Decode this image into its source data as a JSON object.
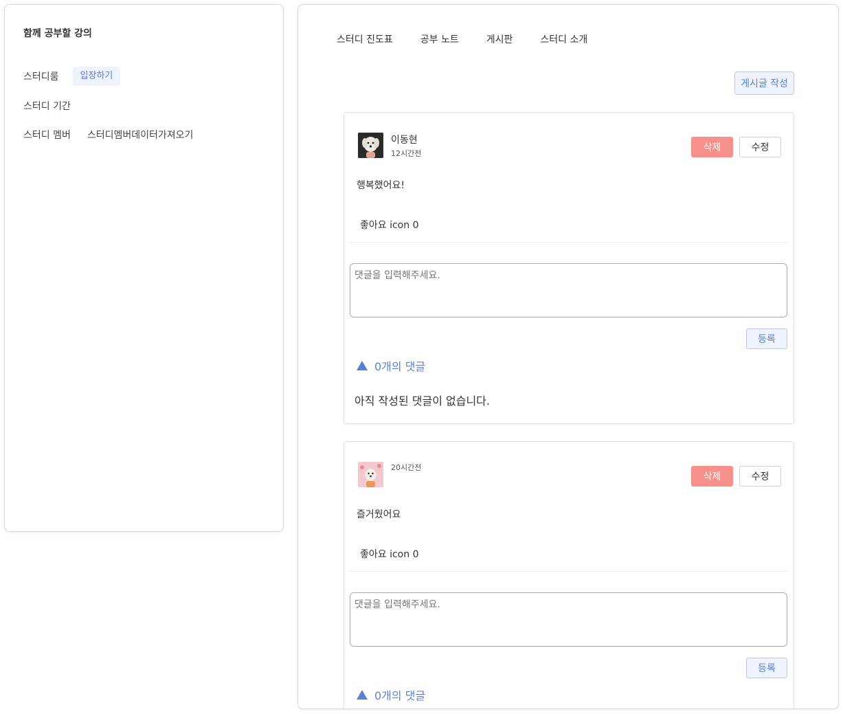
{
  "left": {
    "title": "함께 공부할 강의",
    "room_label": "스터디룸",
    "enter_button": "입장하기",
    "period_label": "스터디 기간",
    "member_label": "스터디 멤버",
    "member_value": "스터디멤버데이터가져오기"
  },
  "tabs": [
    "스터디 진도표",
    "공부 노트",
    "게시판",
    "스터디 소개"
  ],
  "write_button": "게시글 작성",
  "posts": [
    {
      "author": "이동현",
      "time": "12시간전",
      "content": "행복했어요!",
      "likes": "좋아요 icon 0",
      "delete": "삭제",
      "edit": "수정",
      "comment_placeholder": "댓글을 입력해주세요.",
      "submit": "등록",
      "comment_count": "0개의 댓글",
      "no_comments": "아직 작성된 댓글이 없습니다."
    },
    {
      "author": "",
      "time": "20시간전",
      "content": "즐거웠어요",
      "likes": "좋아요 icon 0",
      "delete": "삭제",
      "edit": "수정",
      "comment_placeholder": "댓글을 입력해주세요.",
      "submit": "등록",
      "comment_count": "0개의 댓글"
    }
  ],
  "colors": {
    "accent": "#5b7fd6",
    "accent_bg": "#eef3fd",
    "delete": "#f5908a"
  }
}
